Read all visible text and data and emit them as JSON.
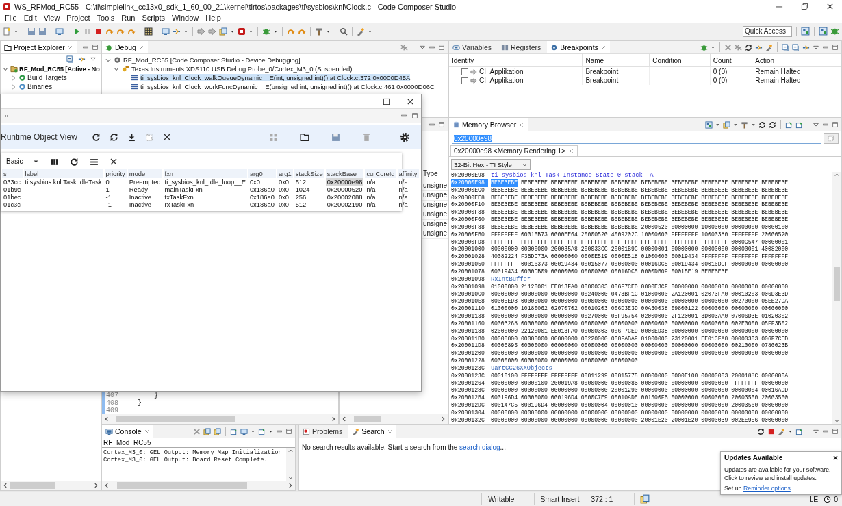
{
  "window": {
    "title": "WS_RFMod_RC55 - C:\\ti\\simplelink_cc13x0_sdk_1_60_00_21\\kernel\\tirtos\\packages\\ti\\sysbios\\knl\\Clock.c - Code Composer Studio"
  },
  "menu": [
    "File",
    "Edit",
    "View",
    "Project",
    "Tools",
    "Run",
    "Scripts",
    "Window",
    "Help"
  ],
  "quick_access": {
    "placeholder": "Quick Access"
  },
  "project_explorer": {
    "title": "Project Explorer",
    "items": [
      {
        "label": "RF_Mod_RC55  [Active - No",
        "expanded": true,
        "children": [
          {
            "label": "Build Targets",
            "expanded": false
          },
          {
            "label": "Binaries",
            "expanded": false
          }
        ]
      }
    ]
  },
  "debug": {
    "title": "Debug",
    "tree": [
      {
        "label": "RF_Mod_RC55 [Code Composer Studio - Device Debugging]",
        "expanded": true,
        "children": [
          {
            "label": "Texas Instruments XDS110 USB Debug Probe_0/Cortex_M3_0 (Suspended)",
            "expanded": true,
            "frames": [
              {
                "label": "ti_sysbios_knl_Clock_walkQueueDynamic__E(int, unsigned int)() at Clock.c:372 0x0000D45A",
                "selected": true
              },
              {
                "label": "ti_sysbios_knl_Clock_workFuncDynamic__E(unsigned int, unsigned int)() at Clock.c:461 0x0000D06C",
                "selected": false
              }
            ]
          }
        ]
      }
    ]
  },
  "breakpoints_panel": {
    "tabs": [
      {
        "label": "Variables",
        "selected": false
      },
      {
        "label": "Registers",
        "selected": false
      },
      {
        "label": "Breakpoints",
        "selected": true
      }
    ],
    "columns": [
      "Identity",
      "Name",
      "Condition",
      "Count",
      "Action"
    ],
    "rows": [
      {
        "checked": false,
        "identity": "CI_Applikation",
        "name": "Breakpoint",
        "count": "0 (0)",
        "action": "Remain Halted"
      },
      {
        "checked": false,
        "identity": "CI_Applikation",
        "name": "Breakpoint",
        "count": "0 (0)",
        "action": "Remain Halted"
      }
    ]
  },
  "runtime_view": {
    "title": "Runtime Object View",
    "view_select": "Basic",
    "columns": [
      "s",
      "label",
      "priority",
      "mode",
      "fxn",
      "arg0",
      "arg1",
      "stackSize",
      "stackBase",
      "curCoreId",
      "affinity"
    ],
    "rows": [
      {
        "s": "033cc",
        "label": "ti.sysbios.knl.Task.IdleTask",
        "priority": "0",
        "mode": "Preempted",
        "fxn": "ti_sysbios_knl_Idle_loop__E",
        "arg0": "0x0",
        "arg1": "0x0",
        "stack_size": "512",
        "stack_base": "0x20000e98",
        "stack_base_selected": true,
        "cur_core_id": "n/a",
        "affinity": "n/a"
      },
      {
        "s": "01b9c",
        "priority": "1",
        "mode": "Ready",
        "fxn": "mainTaskFxn",
        "arg0": "0x186a0",
        "arg1": "0x0",
        "stack_size": "1024",
        "stack_base": "0x20000520",
        "stack_base_selected": false,
        "cur_core_id": "n/a",
        "affinity": "n/a"
      },
      {
        "s": "01bec",
        "priority": "-1",
        "mode": "Inactive",
        "fxn": "txTaskFxn",
        "arg0": "0x186a0",
        "arg1": "0x0",
        "stack_size": "256",
        "stack_base": "0x20002088",
        "stack_base_selected": false,
        "cur_core_id": "n/a",
        "affinity": "n/a"
      },
      {
        "s": "01c3c",
        "priority": "-1",
        "mode": "Inactive",
        "fxn": "rxTaskFxn",
        "arg0": "0x186a0",
        "arg1": "0x0",
        "stack_size": "512",
        "stack_base": "0x20002190",
        "stack_base_selected": false,
        "cur_core_id": "n/a",
        "affinity": "n/a"
      }
    ]
  },
  "editor": {
    "lines": [
      {
        "number": "407",
        "code": "        }"
      },
      {
        "number": "408",
        "code": "    }"
      },
      {
        "number": "409"
      }
    ]
  },
  "type_panel": {
    "header": "Type",
    "cells": [
      "unsigne",
      "unsigne",
      "unsigne",
      "unsigne",
      "unsigne",
      "unsigne"
    ]
  },
  "memory_browser": {
    "title": "Memory Browser",
    "address": "0x20000e98",
    "rendering_tab": "0x20000e98 <Memory Rendering 1>",
    "format": "32-Bit Hex - TI Style",
    "rows": [
      {
        "kind": "label",
        "address": "0x20000E98",
        "label": "ti_sysbios_knl_Task_Instance_State_0_stack__A",
        "selected": false
      },
      {
        "kind": "data",
        "address": "0x20000E98",
        "words": "BEBEBEBE BEBEBEBE BEBEBEBE BEBEBEBE BEBEBEBE BEBEBEBE BEBEBEBE BEBEBEBE BEBEBEBE BEBEBEBE",
        "selected": true
      },
      {
        "kind": "data",
        "address": "0x20000EC0",
        "words": "BEBEBEBE BEBEBEBE BEBEBEBE BEBEBEBE BEBEBEBE BEBEBEBE BEBEBEBE BEBEBEBE BEBEBEBE BEBEBEBE",
        "selected": false
      },
      {
        "kind": "data",
        "address": "0x20000EE8",
        "words": "BEBEBEBE BEBEBEBE BEBEBEBE BEBEBEBE BEBEBEBE BEBEBEBE BEBEBEBE BEBEBEBE BEBEBEBE BEBEBEBE",
        "selected": false
      },
      {
        "kind": "data",
        "address": "0x20000F10",
        "words": "BEBEBEBE BEBEBEBE BEBEBEBE BEBEBEBE BEBEBEBE BEBEBEBE BEBEBEBE BEBEBEBE BEBEBEBE BEBEBEBE",
        "selected": false
      },
      {
        "kind": "data",
        "address": "0x20000F38",
        "words": "BEBEBEBE BEBEBEBE BEBEBEBE BEBEBEBE BEBEBEBE BEBEBEBE BEBEBEBE BEBEBEBE BEBEBEBE BEBEBEBE",
        "selected": false
      },
      {
        "kind": "data",
        "address": "0x20000F60",
        "words": "BEBEBEBE BEBEBEBE BEBEBEBE BEBEBEBE BEBEBEBE BEBEBEBE BEBEBEBE BEBEBEBE BEBEBEBE BEBEBEBE",
        "selected": false
      },
      {
        "kind": "data",
        "address": "0x20000F88",
        "words": "BEBEBEBE BEBEBEBE BEBEBEBE BEBEBEBE BEBEBEBE 20000520 00000000 10000000 00000000 00000100",
        "selected": false
      },
      {
        "kind": "data",
        "address": "0x20000FB0",
        "words": "FFFFFFFF 00016B73 0000EE64 20000520 4009202C 10000000 FFFFFFFF 10000380 FFFFFFFF 20000520",
        "selected": false
      },
      {
        "kind": "data",
        "address": "0x20000FD8",
        "words": "FFFFFFFF FFFFFFFF FFFFFFFF FFFFFFFF FFFFFFFF FFFFFFFF FFFFFFFF FFFFFFFF 0000C547 00000001",
        "selected": false
      },
      {
        "kind": "data",
        "address": "0x20001000",
        "words": "00000000 00000000 200035A8 200033CC 20001B9C 00000001 00000000 00000000 00000001 40082000",
        "selected": false
      },
      {
        "kind": "data",
        "address": "0x20001028",
        "words": "40082224 F3BDC73A 00000000 0000E519 0000E518 01000000 00019434 FFFFFFFF FFFFFFFF FFFFFFFF",
        "selected": false
      },
      {
        "kind": "data",
        "address": "0x20001050",
        "words": "FFFFFFFF 00016373 00019434 00015077 00000000 00016DC5 00019434 00016DCF 00000000 00000000",
        "selected": false
      },
      {
        "kind": "data",
        "address": "0x20001078",
        "words": "00019434 0000DB09 00000000 00000000 00016DC5 0000DB09 00015E19 BEBEBEBE",
        "selected": false
      },
      {
        "kind": "label",
        "address": "0x20001098",
        "label": "RxIntBuffer",
        "selected": false
      },
      {
        "kind": "data",
        "address": "0x20001098",
        "words": "01000000 21120001 EE013FA0 00000303 006F7CED 0000E3CF 00000000 00000000 00000000 00000000",
        "selected": false
      },
      {
        "kind": "data",
        "address": "0x200010C0",
        "words": "00000000 00000000 00000000 00240000 0473BF1C 01000000 2A120001 02073FA0 00010203 006D3E3D",
        "selected": false
      },
      {
        "kind": "data",
        "address": "0x200010E8",
        "words": "00005ED8 00000000 00000000 00000000 00000000 00000000 00000000 00000000 00270000 05EE27DA",
        "selected": false
      },
      {
        "kind": "data",
        "address": "0x20001110",
        "words": "01000000 10180062 02070702 00010203 006D3E3D 00A30038 09800122 00000000 00000000 00000000",
        "selected": false
      },
      {
        "kind": "data",
        "address": "0x20001138",
        "words": "00000000 00000000 00000000 00270000 05F95754 02000000 2F120001 3D003AA0 07006D3E 01020302",
        "selected": false
      },
      {
        "kind": "data",
        "address": "0x20001160",
        "words": "0000B268 00000000 00000000 00000000 00000000 00000000 00000000 00000000 002E0000 05FF3B02",
        "selected": false
      },
      {
        "kind": "data",
        "address": "0x20001188",
        "words": "02000000 22120001 EE013FA0 00000303 006F7CED 0000ED38 00000000 00000000 00000000 00000000",
        "selected": false
      },
      {
        "kind": "data",
        "address": "0x200011B0",
        "words": "00000000 00000000 00000000 00220000 060FABA9 01000000 23120001 EE013FA0 00000303 006F7CED",
        "selected": false
      },
      {
        "kind": "data",
        "address": "0x200011D8",
        "words": "0000E895 00000000 00000000 00000000 00000000 00000000 00000000 00000000 00210000 0780023B",
        "selected": false
      },
      {
        "kind": "data",
        "address": "0x20001200",
        "words": "00000000 00000000 00000000 00000000 00000000 00000000 00000000 00000000 00000000 00000000",
        "selected": false
      },
      {
        "kind": "data",
        "address": "0x20001228",
        "words": "00000000 00000000 00000000 00000000 00000000",
        "selected": false
      },
      {
        "kind": "label",
        "address": "0x2000123C",
        "label": "uartCC26XXObjects",
        "selected": false
      },
      {
        "kind": "data",
        "address": "0x2000123C",
        "words": "00010100 FFFFFFFF FFFFFFFF 00011299 00015775 00000000 0000E100 00000003 2000188C 0000000A",
        "selected": false
      },
      {
        "kind": "data",
        "address": "0x20001264",
        "words": "00000000 00000100 200019A8 00000000 0000008B 00000000 00000000 00000000 FFFFFFFF 00000000",
        "selected": false
      },
      {
        "kind": "data",
        "address": "0x2000128C",
        "words": "00000000 00000000 00000000 00000000 20001290 00000000 00000000 00000000 00000004 00016ADD",
        "selected": false
      },
      {
        "kind": "data",
        "address": "0x200012B4",
        "words": "000196D4 00000000 000196D4 0000C7E9 00010ADE 001500FB 00000000 00000000 20003560 20003560",
        "selected": false
      },
      {
        "kind": "data",
        "address": "0x200012DC",
        "words": "000147C5 000196D4 00000000 00000004 00000010 00000000 00000000 00000000 20003560 00000000",
        "selected": false
      },
      {
        "kind": "data",
        "address": "0x20001304",
        "words": "00000000 00000000 00000000 00000000 00000000 00000000 00000000 00000000 00000000 00000000",
        "selected": false
      },
      {
        "kind": "data",
        "address": "0x2000132C",
        "words": "00000000 00000000 00000000 00000000 00000000 20001E20 20001E20 000000B9 002EE9E6 00000000",
        "selected": false
      }
    ]
  },
  "console": {
    "title": "Console",
    "name": "RF_Mod_RC55",
    "lines": [
      "Cortex_M3_0: GEL Output: Memory Map Initialization",
      "Cortex_M3_0: GEL Output: Board Reset Complete."
    ]
  },
  "search_panel": {
    "tabs": [
      {
        "label": "Problems",
        "selected": false
      },
      {
        "label": "Search",
        "selected": true
      }
    ],
    "message": "No search results available. Start a search from the",
    "link": "search dialog",
    "after": "..."
  },
  "status_bar": {
    "items": [
      "Writable",
      "Smart Insert",
      "372 : 1"
    ],
    "encoding": "LE",
    "count": "0"
  },
  "notification": {
    "title": "Updates Available",
    "close": "×",
    "text": "Updates are available for your software. Click to review and install updates.",
    "setup_text": "Set up",
    "link": "Reminder options"
  }
}
